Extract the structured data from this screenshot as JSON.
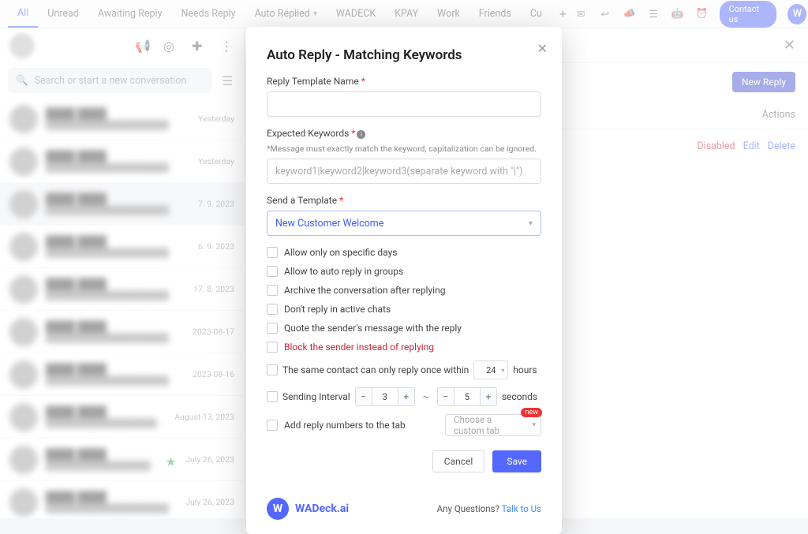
{
  "topTabs": {
    "items": [
      "All",
      "Unread",
      "Awaiting Reply",
      "Needs Reply",
      "Auto Replied",
      "WADECK",
      "KPAY",
      "Work",
      "Friends",
      "Cu"
    ],
    "activeIndex": 0,
    "dropdownIndex": 4
  },
  "topRight": {
    "contactUs": "Contact us"
  },
  "leftPanel": {
    "searchPlaceholder": "Search or start a new conversation",
    "conversations": [
      {
        "date": "Yesterday",
        "star": false
      },
      {
        "date": "Yesterday",
        "star": false
      },
      {
        "date": "7. 9. 2023",
        "star": false,
        "selected": true
      },
      {
        "date": "6. 9. 2023",
        "star": false
      },
      {
        "date": "17. 8. 2023",
        "star": false
      },
      {
        "date": "2023-08-17",
        "star": false
      },
      {
        "date": "2023-08-16",
        "star": false
      },
      {
        "date": "August 13, 2023",
        "star": false
      },
      {
        "date": "July 26, 2023",
        "star": true
      },
      {
        "date": "July 26, 2023",
        "star": false
      }
    ]
  },
  "rightPanel": {
    "newReply": "New Reply",
    "colActions": "Actions",
    "row": {
      "disabled": "Disabled",
      "edit": "Edit",
      "delete": "Delete"
    }
  },
  "modal": {
    "title": "Auto Reply - Matching Keywords",
    "templateNameLabel": "Reply Template Name",
    "keywordsLabel": "Expected Keywords",
    "keywordsHint": "*Message must exactly match the keyword, capitalization can be ignored.",
    "keywordsPlaceholder": "keyword1|keyword2|keyword3(separate keyword with \"|\")",
    "sendTemplateLabel": "Send a Template",
    "sendTemplateValue": "New Customer Welcome",
    "opts": {
      "specificDays": "Allow only on specific days",
      "groups": "Allow to auto reply in groups",
      "archive": "Archive the conversation after replying",
      "activeChats": "Don't reply in active chats",
      "quote": "Quote the sender's message with the reply",
      "block": "Block the sender instead of replying"
    },
    "onceWithin": {
      "pre": "The same contact can only reply once within",
      "value": "24",
      "unit": "hours"
    },
    "interval": {
      "label": "Sending Interval",
      "min": "3",
      "max": "5",
      "unit": "seconds"
    },
    "addNumbers": {
      "label": "Add reply numbers to the tab",
      "placeholder": "Choose a custom tab",
      "badge": "new"
    },
    "buttons": {
      "cancel": "Cancel",
      "save": "Save"
    },
    "footer": {
      "brand": "WADeck.ai",
      "questionPre": "Any Questions? ",
      "talk": "Talk to Us"
    }
  }
}
